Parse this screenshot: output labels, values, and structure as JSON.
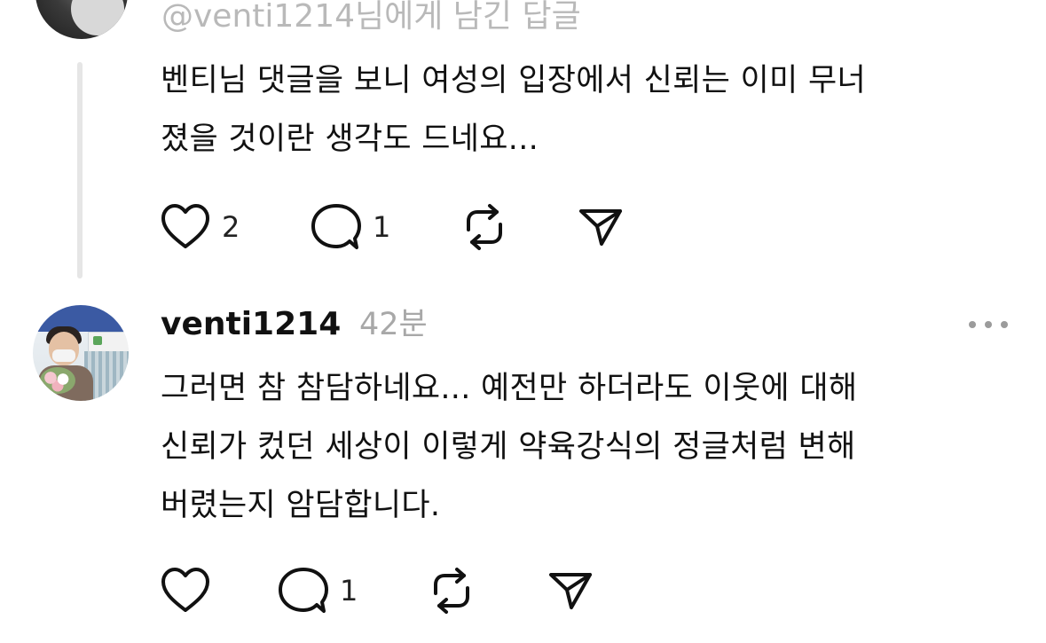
{
  "thread_reply": {
    "reply_to": "@venti1214님에게 남긴 답글",
    "text": "벤티님 댓글을 보니 여성의 입장에서 신뢰는 이미 무너\n졌을 것이란 생각도 드네요...",
    "actions": {
      "like_icon": "heart-icon",
      "like_count": "2",
      "comment_icon": "comment-bubble-icon",
      "comment_count": "1",
      "repost_icon": "repost-icon",
      "share_icon": "send-icon"
    }
  },
  "reply": {
    "username": "venti1214",
    "time": "42분",
    "text": "그러면 참 참담하네요... 예전만 하더라도 이웃에 대해\n신뢰가 컸던 세상이 이렇게 약육강식의 정글처럼 변해\n버렸는지 암담합니다.",
    "actions": {
      "like_icon": "heart-icon",
      "like_count": "",
      "comment_icon": "comment-bubble-icon",
      "comment_count": "1",
      "repost_icon": "repost-icon",
      "share_icon": "send-icon"
    }
  },
  "colors": {
    "text": "#111111",
    "muted": "#a8a8a8",
    "thread_line": "#e6e6e6"
  }
}
